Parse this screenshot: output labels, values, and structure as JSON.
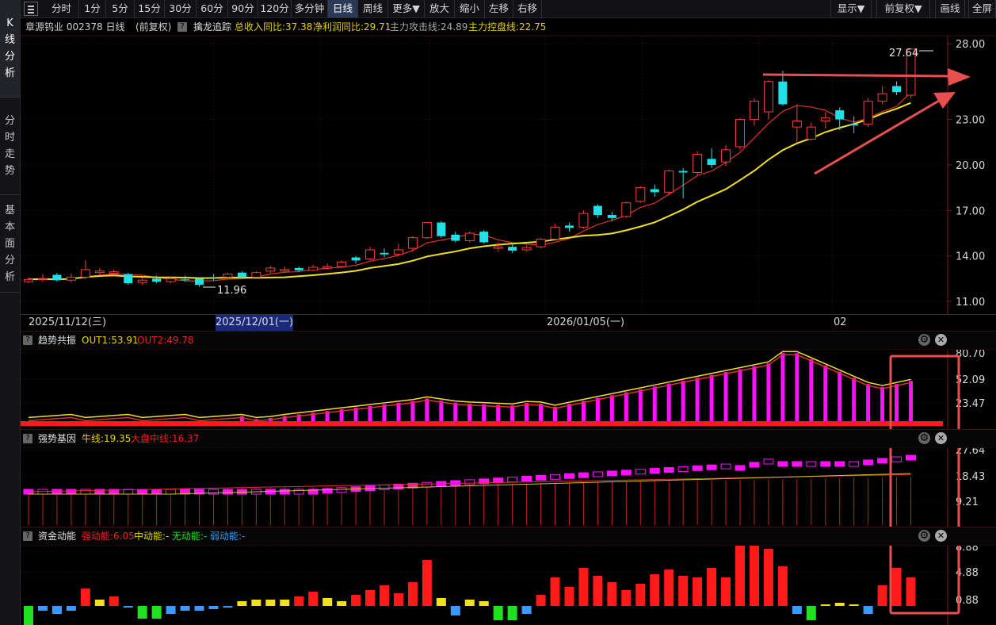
{
  "left_tabs": [
    {
      "label": "K线分析"
    },
    {
      "label": "分时走势"
    },
    {
      "label": "基本面分析"
    }
  ],
  "toolbar": {
    "items": [
      "分时",
      "1分",
      "5分",
      "15分",
      "30分",
      "60分",
      "90分",
      "120分",
      "多分钟",
      "日线",
      "周线",
      "更多▼",
      "放大",
      "缩小",
      "左移",
      "右移"
    ],
    "selected": "日线",
    "right_items": [
      "显示▼",
      "前复权▼",
      "画线",
      "全屏"
    ]
  },
  "info": {
    "stock": "章源钨业 002378 日线",
    "adjust": "(前复权)",
    "indicator": "擒龙追踪",
    "revenue_growth": "总收入同比:37.38",
    "profit_growth": "净利润同比:29.71",
    "attack_line": "主力攻击线:24.89",
    "control_line": "主力控盘线:22.75"
  },
  "main_chart": {
    "y_ticks": [
      "28.00",
      "23.00",
      "20.00",
      "17.00",
      "14.00",
      "11.00"
    ],
    "y_values": [
      28,
      23,
      20,
      17,
      14,
      11
    ],
    "high_label": "27.64",
    "low_label": "11.96"
  },
  "date_axis": {
    "labels": [
      "2025/11/12(三)",
      "2025/12/01(一)",
      "2026/01/05(一)",
      "02"
    ]
  },
  "panel1": {
    "name": "趋势共振",
    "out1": "OUT1:53.91",
    "out2": "OUT2:49.78",
    "y_ticks": [
      "80.70",
      "52.09",
      "23.47"
    ]
  },
  "panel2": {
    "name": "强势基因",
    "bull": "牛线:19.35",
    "market": "大盘中线:16.37",
    "y_ticks": [
      "27.64",
      "18.43",
      "9.21"
    ]
  },
  "panel3": {
    "name": "资金动能",
    "strong": "强动能:6.05",
    "mid": "中动能:-",
    "none": "无动能:-",
    "weak": "弱动能:-",
    "y_ticks": [
      "8.88",
      "4.88",
      "0.88"
    ]
  },
  "chart_data": {
    "type": "candlestick",
    "title": "章源钨业 002378 日线",
    "ylim": [
      11,
      28
    ],
    "candles": [
      [
        12.3,
        12.45,
        12.2,
        12.6
      ],
      [
        12.45,
        12.5,
        12.3,
        12.8
      ],
      [
        12.75,
        12.4,
        12.3,
        12.9
      ],
      [
        12.4,
        12.6,
        12.25,
        12.85
      ],
      [
        12.6,
        13.1,
        12.45,
        13.7
      ],
      [
        12.9,
        13.0,
        12.7,
        13.2
      ],
      [
        12.85,
        12.95,
        12.7,
        13.1
      ],
      [
        12.8,
        12.2,
        12.1,
        12.9
      ],
      [
        12.25,
        12.4,
        12.1,
        12.6
      ],
      [
        12.5,
        12.3,
        12.2,
        12.7
      ],
      [
        12.3,
        12.5,
        12.2,
        12.6
      ],
      [
        12.45,
        12.4,
        12.3,
        12.7
      ],
      [
        12.5,
        12.1,
        11.96,
        12.6
      ],
      [
        12.6,
        12.55,
        12.4,
        12.8
      ],
      [
        12.6,
        12.8,
        12.5,
        12.9
      ],
      [
        12.9,
        12.6,
        12.5,
        13.0
      ],
      [
        12.6,
        12.9,
        12.55,
        13.0
      ],
      [
        13.0,
        13.2,
        12.9,
        13.35
      ],
      [
        13.0,
        13.1,
        12.9,
        13.3
      ],
      [
        13.2,
        13.05,
        12.95,
        13.3
      ],
      [
        13.05,
        13.25,
        13.0,
        13.4
      ],
      [
        13.2,
        13.3,
        13.1,
        13.5
      ],
      [
        13.3,
        13.6,
        13.2,
        13.7
      ],
      [
        13.9,
        13.7,
        13.5,
        14.0
      ],
      [
        13.8,
        14.4,
        13.7,
        14.6
      ],
      [
        14.2,
        14.1,
        13.9,
        14.5
      ],
      [
        14.1,
        14.4,
        14.0,
        14.8
      ],
      [
        14.5,
        15.2,
        14.3,
        15.3
      ],
      [
        15.2,
        16.2,
        15.1,
        16.2
      ],
      [
        16.2,
        15.3,
        15.2,
        16.3
      ],
      [
        15.4,
        15.0,
        14.9,
        15.6
      ],
      [
        15.0,
        15.5,
        14.9,
        15.6
      ],
      [
        15.6,
        14.9,
        14.8,
        15.7
      ],
      [
        14.5,
        14.6,
        14.3,
        14.9
      ],
      [
        14.6,
        14.35,
        14.2,
        14.8
      ],
      [
        14.4,
        14.55,
        14.3,
        14.7
      ],
      [
        14.6,
        15.1,
        14.5,
        15.2
      ],
      [
        15.1,
        15.9,
        15.0,
        16.1
      ],
      [
        16.0,
        15.85,
        15.6,
        16.2
      ],
      [
        15.9,
        16.8,
        15.8,
        17.0
      ],
      [
        17.3,
        16.7,
        16.5,
        17.4
      ],
      [
        16.7,
        16.5,
        16.3,
        16.9
      ],
      [
        16.6,
        17.5,
        16.5,
        17.6
      ],
      [
        17.6,
        18.5,
        17.5,
        18.6
      ],
      [
        18.4,
        18.2,
        17.9,
        18.7
      ],
      [
        18.2,
        19.6,
        18.0,
        19.7
      ],
      [
        19.6,
        19.5,
        17.8,
        19.8
      ],
      [
        19.5,
        20.7,
        19.3,
        20.9
      ],
      [
        20.4,
        20.0,
        19.8,
        21.1
      ],
      [
        20.2,
        21.0,
        19.9,
        21.3
      ],
      [
        21.2,
        23.0,
        21.0,
        23.1
      ],
      [
        23.0,
        24.2,
        22.6,
        24.4
      ],
      [
        23.5,
        25.5,
        23.0,
        25.6
      ],
      [
        25.5,
        24.0,
        23.9,
        26.2
      ],
      [
        22.5,
        22.9,
        21.5,
        24.0
      ],
      [
        21.7,
        22.5,
        21.6,
        22.8
      ],
      [
        22.9,
        23.1,
        22.4,
        23.5
      ],
      [
        23.6,
        23.0,
        22.3,
        23.8
      ],
      [
        22.7,
        22.6,
        22.1,
        23.2
      ],
      [
        22.7,
        24.2,
        22.5,
        24.4
      ],
      [
        24.2,
        24.7,
        24.0,
        25.2
      ],
      [
        25.2,
        24.8,
        24.6,
        25.5
      ],
      [
        24.6,
        27.64,
        24.4,
        27.7
      ]
    ]
  }
}
